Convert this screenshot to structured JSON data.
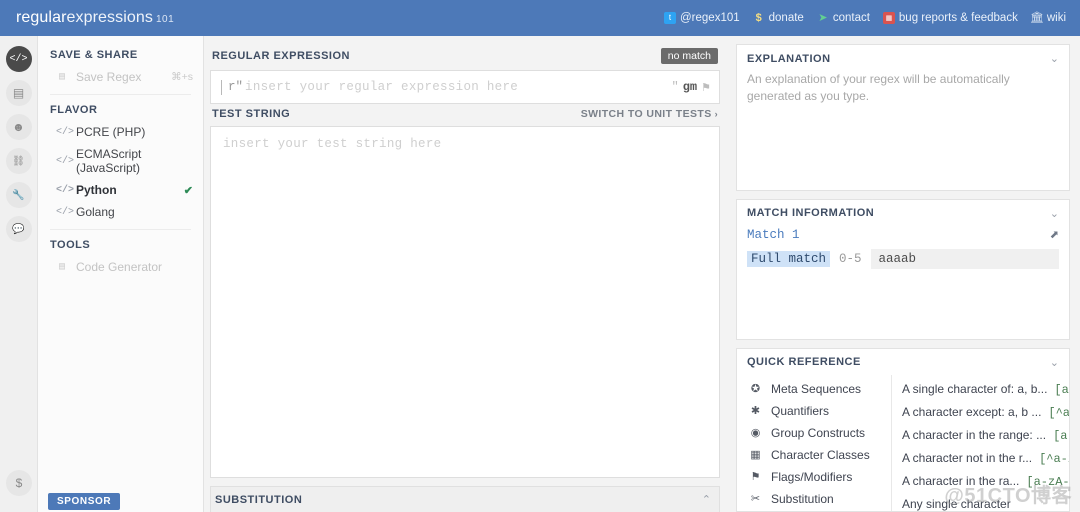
{
  "header": {
    "logo_a": "regular",
    "logo_b": "expressions",
    "logo_c": "101",
    "nav": [
      {
        "label": "@regex101",
        "icon": "twitter-icon",
        "glyph": "t"
      },
      {
        "label": "donate",
        "icon": "dollar-icon",
        "glyph": "$"
      },
      {
        "label": "contact",
        "icon": "send-icon",
        "glyph": "➤"
      },
      {
        "label": "bug reports & feedback",
        "icon": "bug-icon",
        "glyph": "▦"
      },
      {
        "label": "wiki",
        "icon": "bank-icon",
        "glyph": "🏛"
      }
    ]
  },
  "rail": {
    "items": [
      {
        "name": "code-icon",
        "glyph": "</>",
        "active": true
      },
      {
        "name": "book-icon",
        "glyph": "▤",
        "active": false
      },
      {
        "name": "account-icon",
        "glyph": "☻",
        "active": false
      },
      {
        "name": "link-icon",
        "glyph": "⛓",
        "active": false
      },
      {
        "name": "wrench-icon",
        "glyph": "🔧",
        "active": false
      },
      {
        "name": "chat-icon",
        "glyph": "💬",
        "active": false
      }
    ],
    "bottom": {
      "name": "dollar-icon",
      "glyph": "$"
    }
  },
  "sidebar": {
    "save_share_title": "SAVE & SHARE",
    "save_regex_label": "Save Regex",
    "save_regex_shortcut": "⌘+s",
    "flavor_title": "FLAVOR",
    "flavors": [
      {
        "label": "PCRE (PHP)",
        "selected": false
      },
      {
        "label": "ECMAScript (JavaScript)",
        "selected": false
      },
      {
        "label": "Python",
        "selected": true
      },
      {
        "label": "Golang",
        "selected": false
      }
    ],
    "tools_title": "TOOLS",
    "code_generator_label": "Code Generator",
    "sponsor_label": "SPONSOR"
  },
  "regex": {
    "section_title": "REGULAR EXPRESSION",
    "match_badge": "no match",
    "prefix": "r\"",
    "placeholder": "insert your regular expression here",
    "suffix_quote": "\"",
    "flags": "gm"
  },
  "test": {
    "section_title": "TEST STRING",
    "switch_label": "SWITCH TO UNIT TESTS",
    "switch_chevron": "›",
    "placeholder": "insert your test string here"
  },
  "substitution": {
    "title": "SUBSTITUTION",
    "chevron": "⌃"
  },
  "explanation": {
    "title": "EXPLANATION",
    "chevron": "⌄",
    "text": "An explanation of your regex will be automatically generated as you type."
  },
  "match_information": {
    "title": "MATCH INFORMATION",
    "chevron": "⌄",
    "match_label": "Match 1",
    "export_icon": "export-icon",
    "full_match_label": "Full match",
    "range": "0-5",
    "value": "aaaab"
  },
  "quick_reference": {
    "title": "QUICK REFERENCE",
    "chevron": "⌄",
    "categories": [
      {
        "label": "Meta Sequences",
        "icon": "globe-icon",
        "glyph": "✪"
      },
      {
        "label": "Quantifiers",
        "icon": "asterisk-icon",
        "glyph": "✱"
      },
      {
        "label": "Group Constructs",
        "icon": "target-icon",
        "glyph": "◉"
      },
      {
        "label": "Character Classes",
        "icon": "grid-icon",
        "glyph": "▦"
      },
      {
        "label": "Flags/Modifiers",
        "icon": "flag-icon",
        "glyph": "⚑"
      },
      {
        "label": "Substitution",
        "icon": "scissors-icon",
        "glyph": "✂"
      }
    ],
    "references": [
      {
        "desc": "A single character of: a, b...",
        "token": "[abc]"
      },
      {
        "desc": "A character except: a, b ...",
        "token": "[^abc]"
      },
      {
        "desc": "A character in the range: ...",
        "token": "[a-z]"
      },
      {
        "desc": "A character not in the r...",
        "token": "[^a-z]"
      },
      {
        "desc": "A character in the ra...",
        "token": "[a-zA-Z]"
      },
      {
        "desc": "Any single character",
        "token": ""
      }
    ]
  },
  "watermark": "@51CTO博客"
}
